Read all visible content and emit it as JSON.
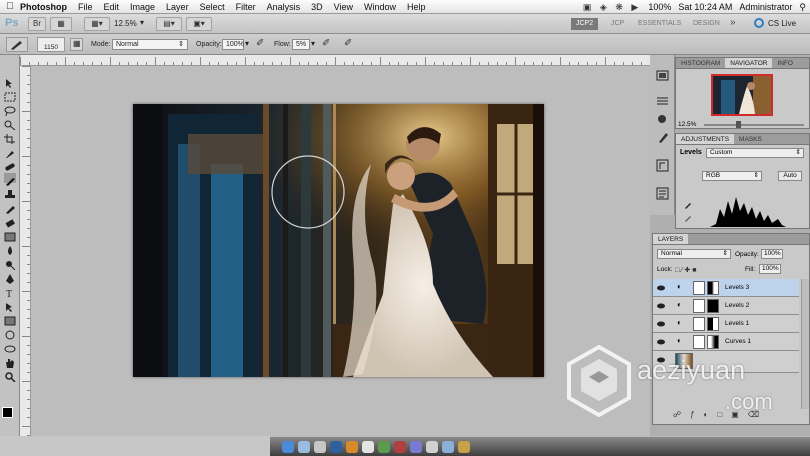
{
  "menubar": {
    "app_name": "Photoshop",
    "items": [
      "File",
      "Edit",
      "Image",
      "Layer",
      "Select",
      "Filter",
      "Analysis",
      "3D",
      "View",
      "Window",
      "Help"
    ],
    "battery": "100%",
    "clock": "Sat 10:24 AM",
    "user": "Administrator"
  },
  "appbar": {
    "logo": "Ps",
    "zoom": "12.5%",
    "workspaces": [
      "JCP2",
      "JCP",
      "ESSENTIALS",
      "DESIGN"
    ],
    "more": "»",
    "cs_live": "CS Live"
  },
  "options": {
    "brush_size": "1150",
    "mode_label": "Mode:",
    "mode_value": "Normal",
    "opacity_label": "Opacity:",
    "opacity_value": "100%",
    "flow_label": "Flow:",
    "flow_value": "5%"
  },
  "navigator": {
    "tabs": [
      "HISTOGRAM",
      "NAVIGATOR",
      "INFO"
    ],
    "active_tab": "NAVIGATOR",
    "zoom": "12.5%"
  },
  "adjustments": {
    "tabs": [
      "ADJUSTMENTS",
      "MASKS"
    ],
    "title": "Levels",
    "preset": "Custom",
    "channel": "RGB",
    "auto_label": "Auto"
  },
  "layers": {
    "tab": "LAYERS",
    "blend_mode": "Normal",
    "opacity_label": "Opacity:",
    "opacity_value": "100%",
    "lock_label": "Lock:",
    "fill_label": "Fill:",
    "fill_value": "100%",
    "rows": [
      {
        "name": "Levels 3",
        "selected": true
      },
      {
        "name": "Levels 2",
        "selected": false
      },
      {
        "name": "Levels 1",
        "selected": false
      },
      {
        "name": "Curves 1",
        "selected": false
      }
    ]
  },
  "watermark": {
    "text": "aeziyuan",
    "suffix": ".com"
  },
  "colors": {
    "selection": "#bdd3ec",
    "workspace_active": "#7a7a7a",
    "ps_blue": "#7aa7c7"
  }
}
